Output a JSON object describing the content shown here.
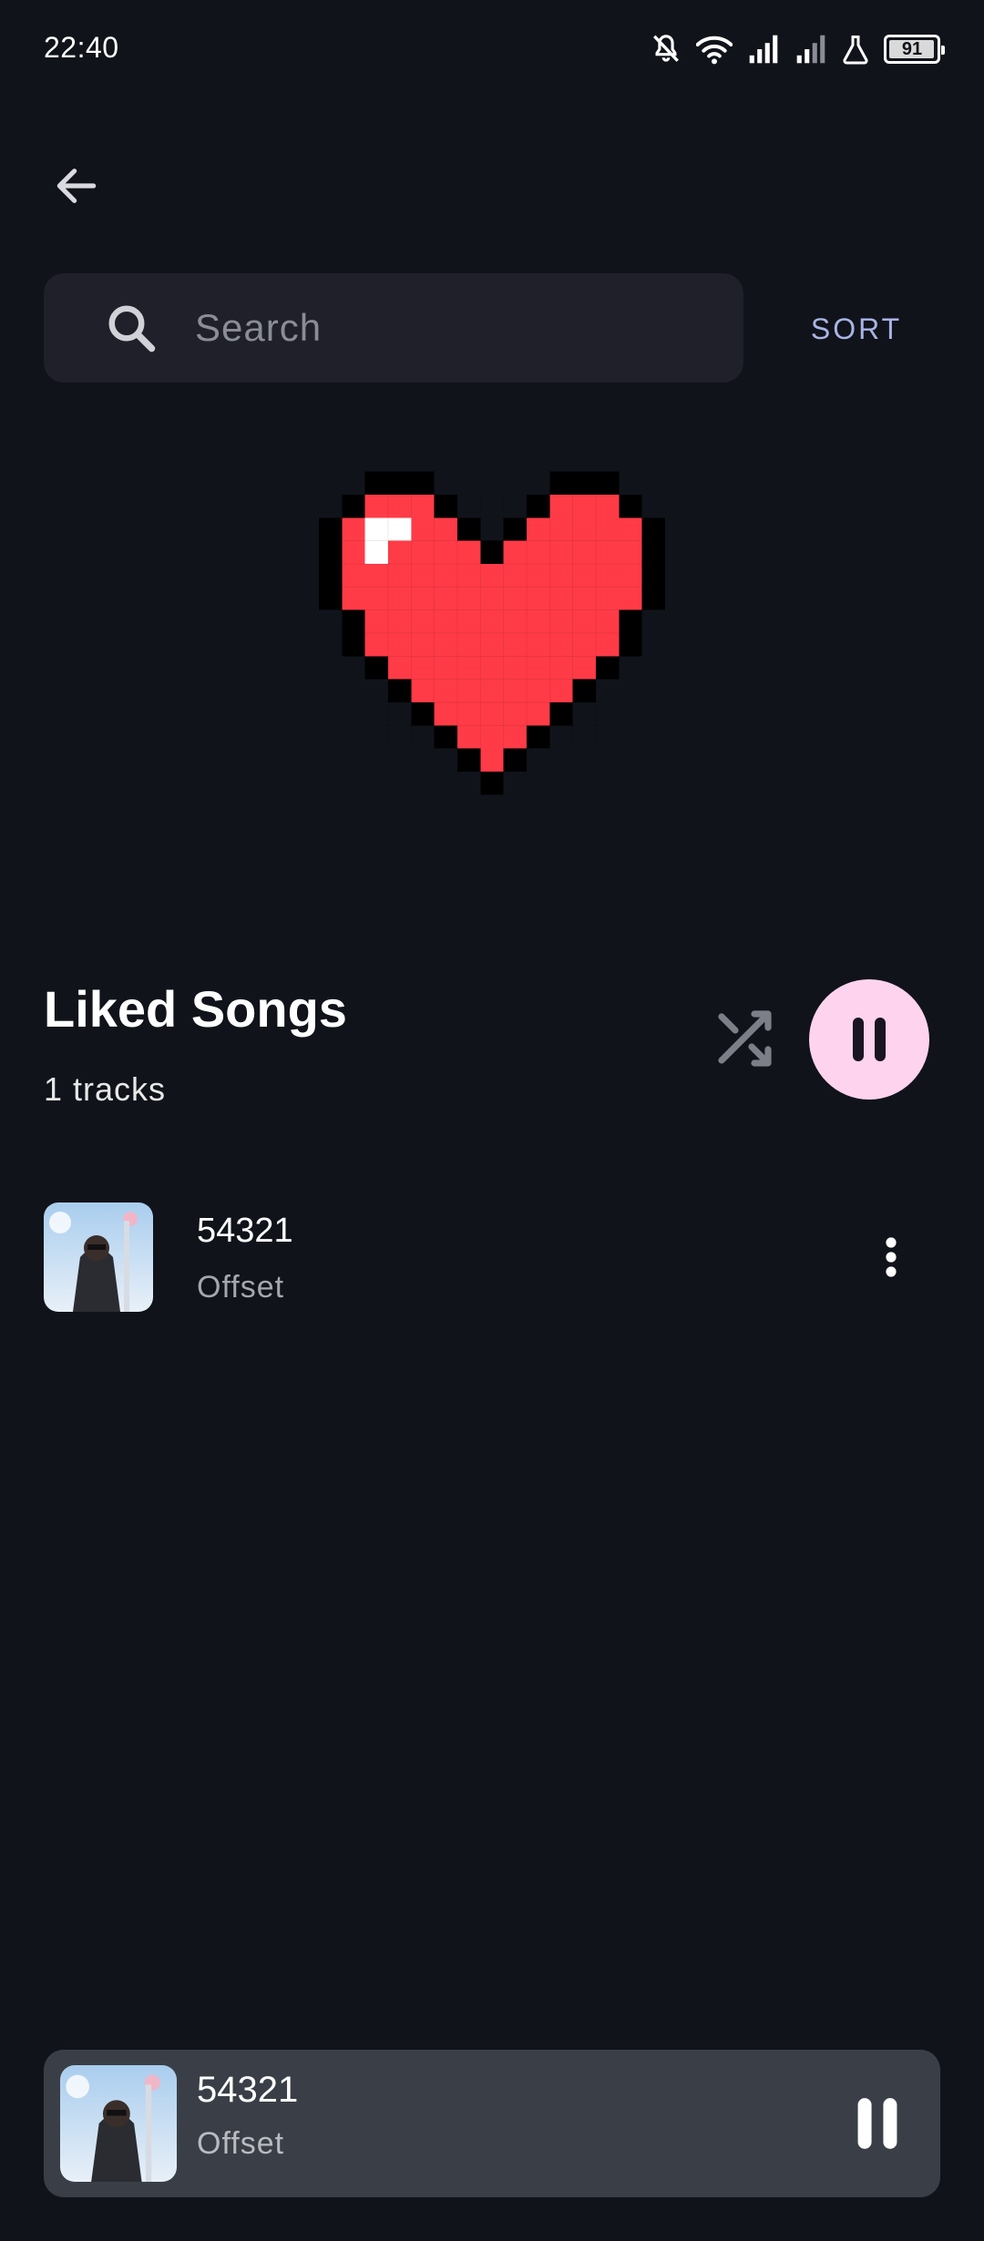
{
  "status_bar": {
    "time": "22:40",
    "battery": "91",
    "icons": [
      "bell-off-icon",
      "wifi-icon",
      "signal-icon",
      "signal-icon",
      "flask-icon",
      "battery-icon"
    ]
  },
  "header": {
    "back_icon": "arrow-left-icon"
  },
  "search": {
    "placeholder": "Search",
    "value": "",
    "icon": "search-icon"
  },
  "sort_label": "SORT",
  "playlist": {
    "title": "Liked Songs",
    "track_count": "1 tracks",
    "cover_icon": "pixel-heart-icon"
  },
  "controls": {
    "shuffle_icon": "shuffle-icon",
    "play_pause_icon": "pause-icon"
  },
  "tracks": [
    {
      "title": "54321",
      "artist": "Offset",
      "menu_icon": "more-vert-icon"
    }
  ],
  "now_playing": {
    "title": "54321",
    "artist": "Offset",
    "control_icon": "pause-icon"
  },
  "colors": {
    "background": "#10131a",
    "search_bg": "#1f2029",
    "accent_sort": "#a9b4e6",
    "play_button": "#fdd3ee",
    "heart_red": "#ff3b47",
    "mini_player_bg": "#3a3f47"
  }
}
